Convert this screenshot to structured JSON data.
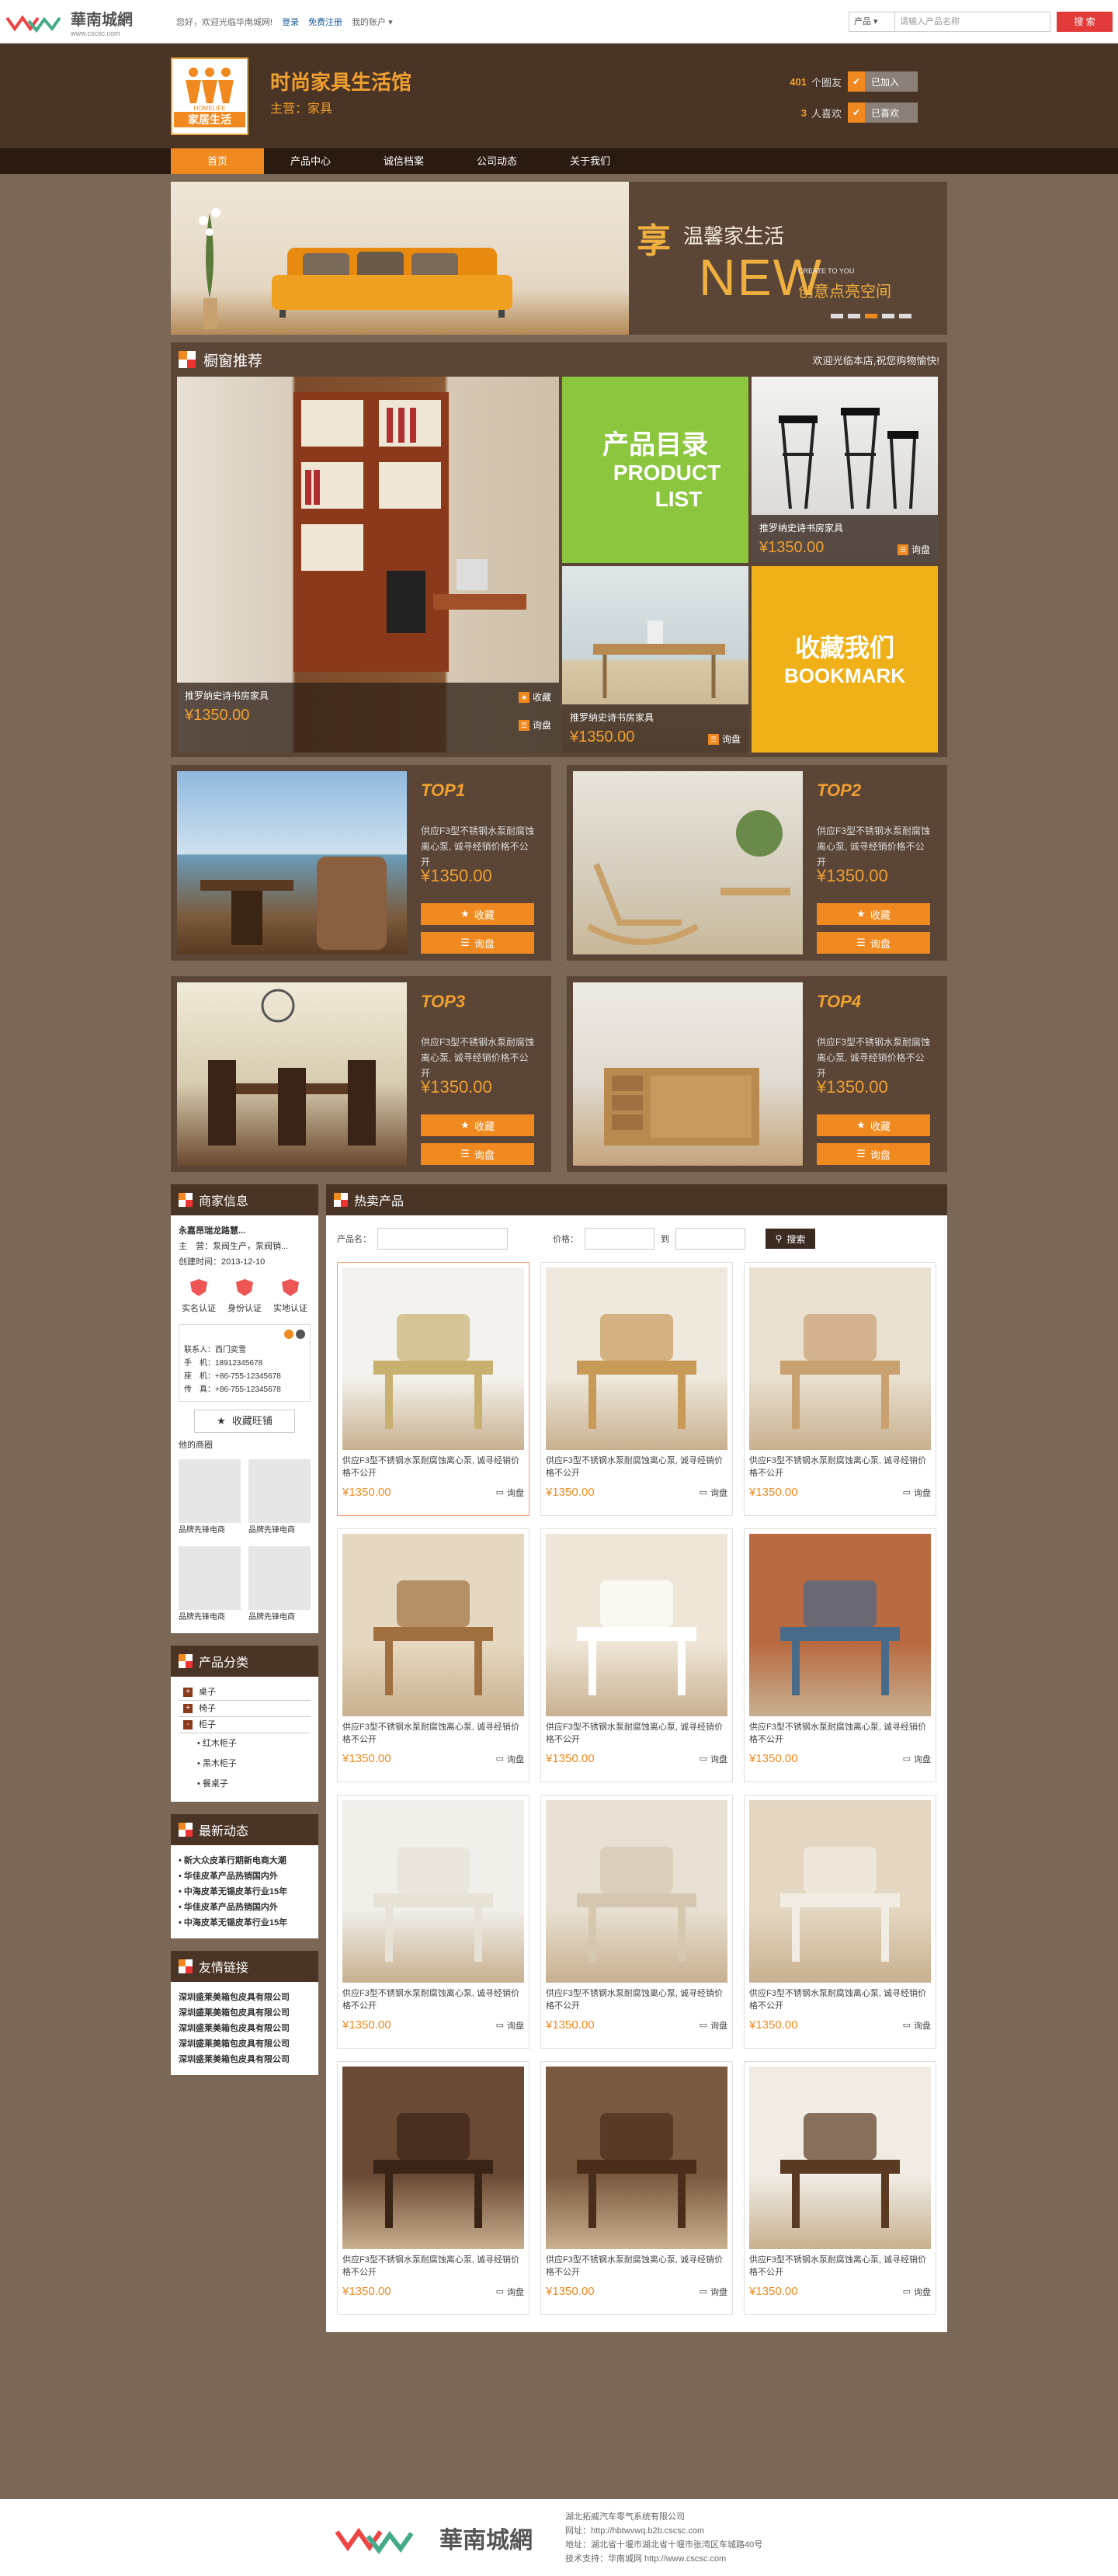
{
  "site": {
    "logo_text": "華南城網",
    "logo_url": "www.cscsc.com"
  },
  "topbar": {
    "welcome": "您好，欢迎光临华南城网!",
    "login": "登录",
    "register": "免费注册",
    "my_account": "我的账户",
    "search_type": "产品",
    "search_placeholder": "请输入产品名称",
    "search_btn": "搜 索"
  },
  "shop": {
    "logo_glyph": "✕✕✕",
    "logo_text": "家居生活",
    "logo_en": "HOMELIFE",
    "name": "时尚家具生活馆",
    "main": "主营：家具",
    "fans_count": "401",
    "fans_label": "个圈友",
    "join_label": "已加入",
    "likes_count": "3",
    "likes_label": "人喜欢",
    "liked_label": "已喜欢"
  },
  "nav": [
    "首页",
    "产品中心",
    "诚信档案",
    "公司动态",
    "关于我们"
  ],
  "banner": {
    "big": "享",
    "t1": "温馨家生活",
    "t2": "NEW",
    "t3": "CREATE TO YOU",
    "t4": "创意点亮空间"
  },
  "window": {
    "title": "橱窗推荐",
    "welcome": "欢迎光临本店,祝您购物愉快!",
    "main_name": "推罗纳史诗书房家具",
    "main_price": "¥1350.00",
    "fav": "收藏",
    "ask": "询盘",
    "catalog_cn": "产品目录",
    "catalog_en1": "PRODUCT",
    "catalog_en2": "LIST",
    "t2_name": "推罗纳史诗书房家具",
    "t2_price": "¥1350.00",
    "t3_name": "推罗纳史诗书房家具",
    "t3_price": "¥1350.00",
    "bm_cn": "收藏我们",
    "bm_en": "BOOKMARK"
  },
  "tops": [
    {
      "rank": "TOP1",
      "desc": "供应F3型不锈钢水泵耐腐蚀离心泵, 诚寻经销价格不公开",
      "price": "¥1350.00",
      "fav": "收藏",
      "ask": "询盘"
    },
    {
      "rank": "TOP2",
      "desc": "供应F3型不锈钢水泵耐腐蚀离心泵, 诚寻经销价格不公开",
      "price": "¥1350.00",
      "fav": "收藏",
      "ask": "询盘"
    },
    {
      "rank": "TOP3",
      "desc": "供应F3型不锈钢水泵耐腐蚀离心泵, 诚寻经销价格不公开",
      "price": "¥1350.00",
      "fav": "收藏",
      "ask": "询盘"
    },
    {
      "rank": "TOP4",
      "desc": "供应F3型不锈钢水泵耐腐蚀离心泵, 诚寻经销价格不公开",
      "price": "¥1350.00",
      "fav": "收藏",
      "ask": "询盘"
    }
  ],
  "merchant": {
    "title": "商家信息",
    "company": "永嘉昂瑞龙路慧...",
    "main": "主　营：泵阀生产，泵阀销...",
    "created": "创建时间：2013-12-10",
    "certs": [
      "实名认证",
      "身份认证",
      "实地认证"
    ],
    "contact": "联系人：西门奕雪",
    "phone": "手　机：18912345678",
    "tel": "座　机：+86-755-12345678",
    "fax": "传　真：+86-755-12345678",
    "ww": "收藏旺铺",
    "other": "他的商圈",
    "shops": [
      "品牌先锋电商",
      "品牌先锋电商",
      "品牌先锋电商",
      "品牌先锋电商"
    ]
  },
  "categories": {
    "title": "产品分类",
    "items": [
      "桌子",
      "椅子",
      "柜子"
    ],
    "subs": [
      "红木柜子",
      "黑木柜子",
      "餐桌子"
    ]
  },
  "news": {
    "title": "最新动态",
    "items": [
      "新大众皮革行期新电商大潮",
      "华佳皮革产品热销国内外",
      "中海皮革无锡皮革行业15年",
      "华佳皮革产品热销国内外",
      "中海皮革无锡皮革行业15年"
    ]
  },
  "links": {
    "title": "友情链接",
    "items": [
      "深圳盛莱美箱包皮具有限公司",
      "深圳盛莱美箱包皮具有限公司",
      "深圳盛莱美箱包皮具有限公司",
      "深圳盛莱美箱包皮具有限公司",
      "深圳盛莱美箱包皮具有限公司"
    ]
  },
  "hot": {
    "title": "热卖产品",
    "name_label": "产品名：",
    "price_label": "价格：",
    "to": "到",
    "search": "搜索",
    "desc": "供应F3型不锈钢水泵耐腐蚀离心泵, 诚寻经销价格不公开",
    "price": "¥1350.00",
    "ask": "询盘"
  },
  "footer": {
    "company": "湖北拓威汽车零气系统有限公司",
    "site": "网址：http://hbtwvwq.b2b.cscsc.com",
    "addr": "地址：湖北省十堰市湖北省十堰市张湾区车城路40号",
    "support": "技术支持：华南城网 http://www.cscsc.com"
  }
}
